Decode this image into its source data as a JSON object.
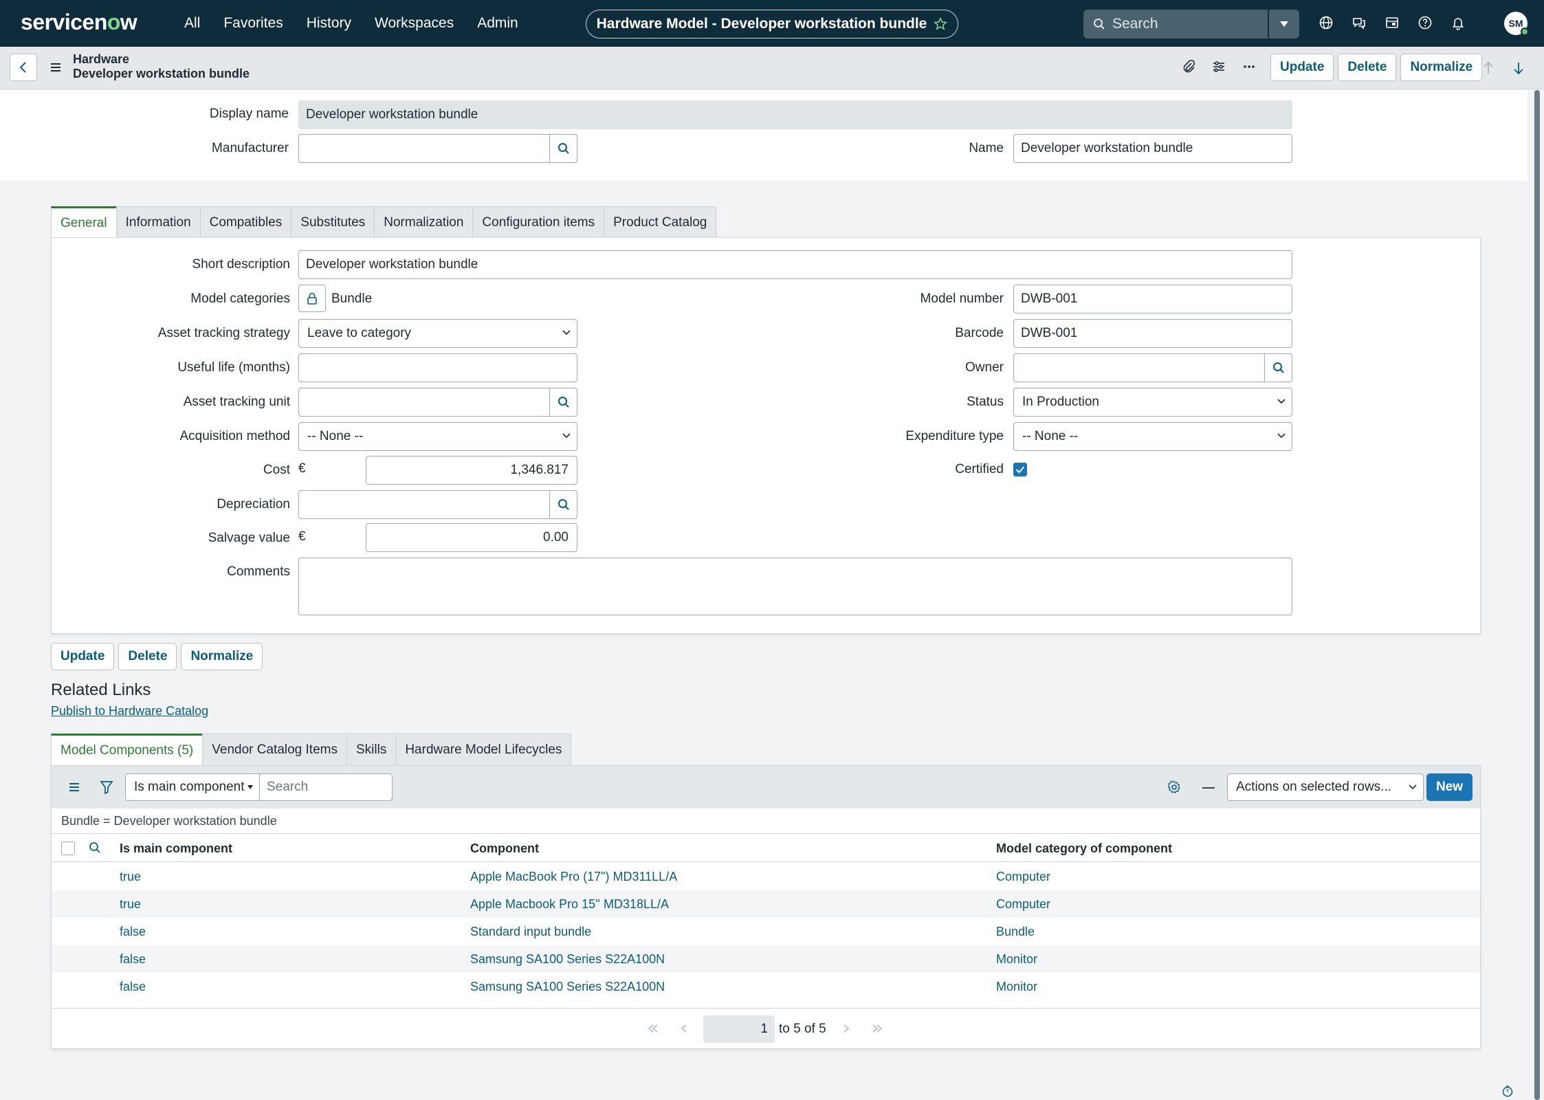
{
  "topnav": {
    "logo_a": "servicen",
    "logo_o": "o",
    "logo_b": "w",
    "links": [
      "All",
      "Favorites",
      "History",
      "Workspaces",
      "Admin"
    ],
    "record_title": "Hardware Model - Developer workstation bundle",
    "search_placeholder": "Search",
    "avatar": "SM"
  },
  "header": {
    "table": "Hardware",
    "record": "Developer workstation bundle",
    "buttons": [
      "Update",
      "Delete",
      "Normalize"
    ]
  },
  "top_fields": {
    "display_name_label": "Display name",
    "display_name": "Developer workstation bundle",
    "manufacturer_label": "Manufacturer",
    "manufacturer": "",
    "name_label": "Name",
    "name": "Developer workstation bundle"
  },
  "tabs": [
    "General",
    "Information",
    "Compatibles",
    "Substitutes",
    "Normalization",
    "Configuration items",
    "Product Catalog"
  ],
  "general": {
    "short_description_label": "Short description",
    "short_description": "Developer workstation bundle",
    "model_categories_label": "Model categories",
    "model_categories": "Bundle",
    "asset_tracking_strategy_label": "Asset tracking strategy",
    "asset_tracking_strategy": "Leave to category",
    "useful_life_label": "Useful life (months)",
    "useful_life": "",
    "asset_tracking_unit_label": "Asset tracking unit",
    "acquisition_method_label": "Acquisition method",
    "acquisition_method": "-- None --",
    "cost_label": "Cost",
    "currency": "€",
    "cost": "1,346.817",
    "depreciation_label": "Depreciation",
    "salvage_value_label": "Salvage value",
    "salvage_value": "0.00",
    "comments_label": "Comments",
    "model_number_label": "Model number",
    "model_number": "DWB-001",
    "barcode_label": "Barcode",
    "barcode": "DWB-001",
    "owner_label": "Owner",
    "status_label": "Status",
    "status": "In Production",
    "expenditure_type_label": "Expenditure type",
    "expenditure_type": "-- None --",
    "certified_label": "Certified",
    "certified": true
  },
  "bottom_buttons": [
    "Update",
    "Delete",
    "Normalize"
  ],
  "related": {
    "title": "Related Links",
    "link": "Publish to Hardware Catalog"
  },
  "related_tabs": [
    "Model Components (5)",
    "Vendor Catalog Items",
    "Skills",
    "Hardware Model Lifecycles"
  ],
  "list": {
    "filter_field": "Is main component",
    "search_placeholder": "Search",
    "actions": "Actions on selected rows...",
    "new_label": "New",
    "breadcrumb": "Bundle = Developer workstation bundle",
    "columns": [
      "Is main component",
      "Component",
      "Model category of component"
    ],
    "rows": [
      [
        "true",
        "Apple MacBook Pro (17\") MD311LL/A",
        "Computer"
      ],
      [
        "true",
        "Apple Macbook Pro 15'' MD318LL/A",
        "Computer"
      ],
      [
        "false",
        "Standard input bundle",
        "Bundle"
      ],
      [
        "false",
        "Samsung SA100 Series S22A100N",
        "Monitor"
      ],
      [
        "false",
        "Samsung SA100 Series S22A100N",
        "Monitor"
      ]
    ],
    "pager_page": "1",
    "pager_text": "to 5 of 5"
  }
}
